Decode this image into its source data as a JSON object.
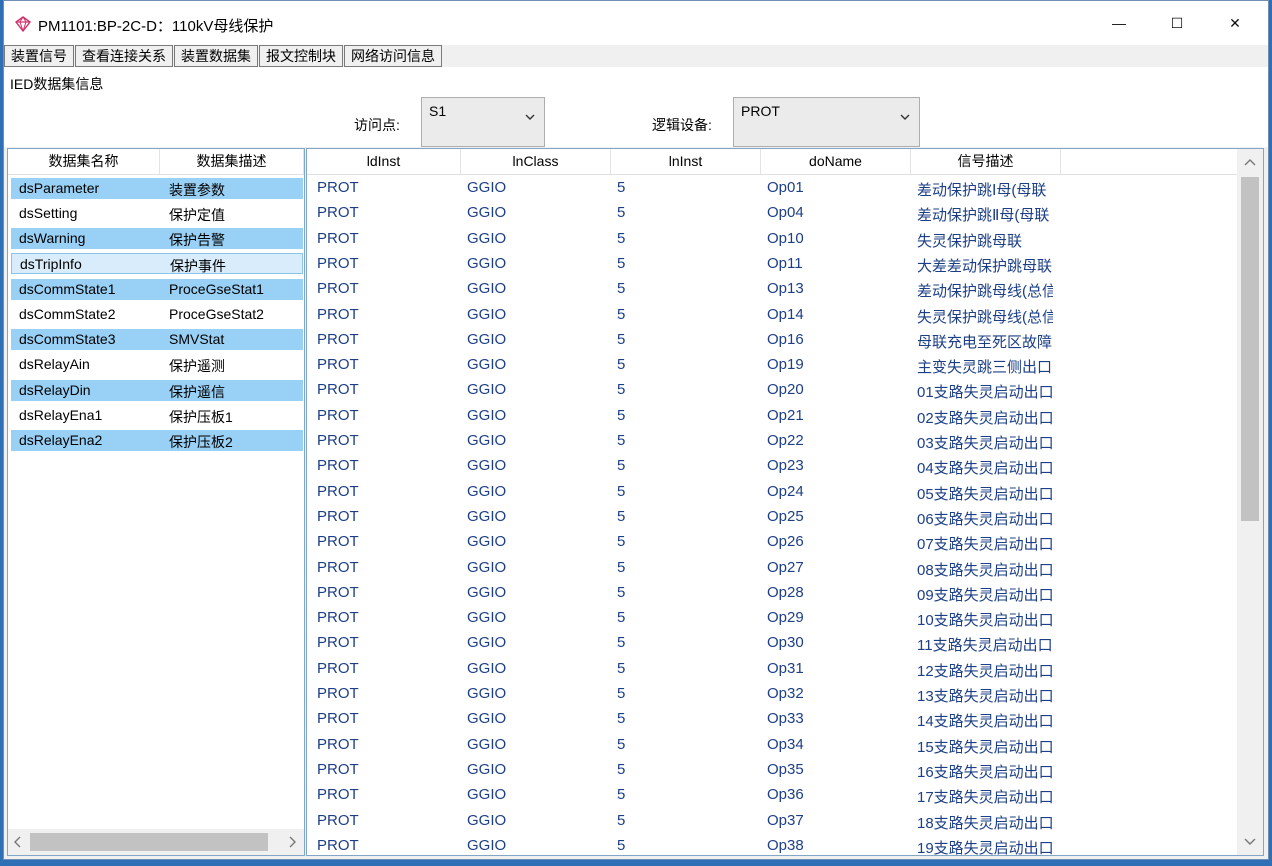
{
  "window": {
    "title": "PM1101:BP-2C-D：110kV母线保护",
    "min_glyph": "—",
    "max_glyph": "☐",
    "close_glyph": "✕"
  },
  "menu": [
    "装置信号",
    "查看连接关系",
    "装置数据集",
    "报文控制块",
    "网络访问信息"
  ],
  "ied_panel": {
    "title": "IED数据集信息",
    "access_point_label": "访问点:",
    "access_point_value": "S1",
    "logic_device_label": "逻辑设备:",
    "logic_device_value": "PROT"
  },
  "dataset_list": {
    "headers": [
      "数据集名称",
      "数据集描述"
    ],
    "rows": [
      [
        "dsParameter",
        "装置参数"
      ],
      [
        "dsSetting",
        "保护定值"
      ],
      [
        "dsWarning",
        "保护告警"
      ],
      [
        "dsTripInfo",
        "保护事件"
      ],
      [
        "dsCommState1",
        "ProceGseStat1"
      ],
      [
        "dsCommState2",
        "ProceGseStat2"
      ],
      [
        "dsCommState3",
        "SMVStat"
      ],
      [
        "dsRelayAin",
        "保护遥测"
      ],
      [
        "dsRelayDin",
        "保护遥信"
      ],
      [
        "dsRelayEna1",
        "保护压板1"
      ],
      [
        "dsRelayEna2",
        "保护压板2"
      ]
    ]
  },
  "grid": {
    "headers": [
      "ldInst",
      "lnClass",
      "lnInst",
      "doName",
      "信号描述"
    ],
    "rows": [
      [
        "PROT",
        "GGIO",
        "5",
        "Op01",
        "差动保护跳Ⅰ母(母联"
      ],
      [
        "PROT",
        "GGIO",
        "5",
        "Op04",
        "差动保护跳Ⅱ母(母联"
      ],
      [
        "PROT",
        "GGIO",
        "5",
        "Op10",
        "失灵保护跳母联"
      ],
      [
        "PROT",
        "GGIO",
        "5",
        "Op11",
        "大差差动保护跳母联"
      ],
      [
        "PROT",
        "GGIO",
        "5",
        "Op13",
        "差动保护跳母线(总信"
      ],
      [
        "PROT",
        "GGIO",
        "5",
        "Op14",
        "失灵保护跳母线(总信"
      ],
      [
        "PROT",
        "GGIO",
        "5",
        "Op16",
        "母联充电至死区故障"
      ],
      [
        "PROT",
        "GGIO",
        "5",
        "Op19",
        "主变失灵跳三侧出口"
      ],
      [
        "PROT",
        "GGIO",
        "5",
        "Op20",
        "01支路失灵启动出口"
      ],
      [
        "PROT",
        "GGIO",
        "5",
        "Op21",
        "02支路失灵启动出口"
      ],
      [
        "PROT",
        "GGIO",
        "5",
        "Op22",
        "03支路失灵启动出口"
      ],
      [
        "PROT",
        "GGIO",
        "5",
        "Op23",
        "04支路失灵启动出口"
      ],
      [
        "PROT",
        "GGIO",
        "5",
        "Op24",
        "05支路失灵启动出口"
      ],
      [
        "PROT",
        "GGIO",
        "5",
        "Op25",
        "06支路失灵启动出口"
      ],
      [
        "PROT",
        "GGIO",
        "5",
        "Op26",
        "07支路失灵启动出口"
      ],
      [
        "PROT",
        "GGIO",
        "5",
        "Op27",
        "08支路失灵启动出口"
      ],
      [
        "PROT",
        "GGIO",
        "5",
        "Op28",
        "09支路失灵启动出口"
      ],
      [
        "PROT",
        "GGIO",
        "5",
        "Op29",
        "10支路失灵启动出口"
      ],
      [
        "PROT",
        "GGIO",
        "5",
        "Op30",
        "11支路失灵启动出口"
      ],
      [
        "PROT",
        "GGIO",
        "5",
        "Op31",
        "12支路失灵启动出口"
      ],
      [
        "PROT",
        "GGIO",
        "5",
        "Op32",
        "13支路失灵启动出口"
      ],
      [
        "PROT",
        "GGIO",
        "5",
        "Op33",
        "14支路失灵启动出口"
      ],
      [
        "PROT",
        "GGIO",
        "5",
        "Op34",
        "15支路失灵启动出口"
      ],
      [
        "PROT",
        "GGIO",
        "5",
        "Op35",
        "16支路失灵启动出口"
      ],
      [
        "PROT",
        "GGIO",
        "5",
        "Op36",
        "17支路失灵启动出口"
      ],
      [
        "PROT",
        "GGIO",
        "5",
        "Op37",
        "18支路失灵启动出口"
      ],
      [
        "PROT",
        "GGIO",
        "5",
        "Op38",
        "19支路失灵启动出口"
      ]
    ]
  },
  "icons": {
    "app": "app-gem-icon",
    "dropdown": "chevron-down-icon",
    "scroll_left": "scroll-left-icon",
    "scroll_right": "scroll-right-icon",
    "scroll_up": "scroll-up-icon",
    "scroll_down": "scroll-down-icon"
  },
  "colors": {
    "selected_row": "#99d0f5",
    "grid_text": "#1c3f86",
    "desktop": "#2f6fb5"
  }
}
